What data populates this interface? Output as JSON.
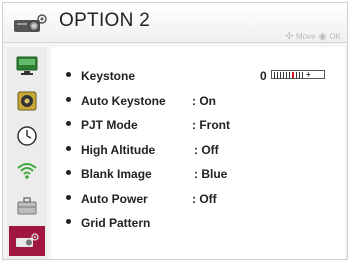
{
  "header": {
    "title": "OPTION 2",
    "hint_move": "Move",
    "hint_ok": "OK",
    "icon": "projector-icon"
  },
  "sidebar": {
    "items": [
      {
        "icon": "picture-monitor-icon",
        "active": false
      },
      {
        "icon": "speaker-audio-icon",
        "active": false
      },
      {
        "icon": "clock-time-icon",
        "active": false
      },
      {
        "icon": "wifi-network-icon",
        "active": false
      },
      {
        "icon": "briefcase-option-icon",
        "active": false
      },
      {
        "icon": "projector-option2-icon",
        "active": true
      }
    ]
  },
  "menu": {
    "items": [
      {
        "label": "Keystone",
        "value": "0"
      },
      {
        "label": "Auto Keystone",
        "value": ": On"
      },
      {
        "label": "PJT Mode",
        "value": ": Front"
      },
      {
        "label": "High Altitude",
        "value": ": Off"
      },
      {
        "label": "Blank Image",
        "value": ": Blue"
      },
      {
        "label": "Auto Power",
        "value": ": Off"
      },
      {
        "label": "Grid Pattern",
        "value": ""
      }
    ]
  },
  "colors": {
    "accent": "#a1163f",
    "slider_marker": "#d2142b"
  }
}
